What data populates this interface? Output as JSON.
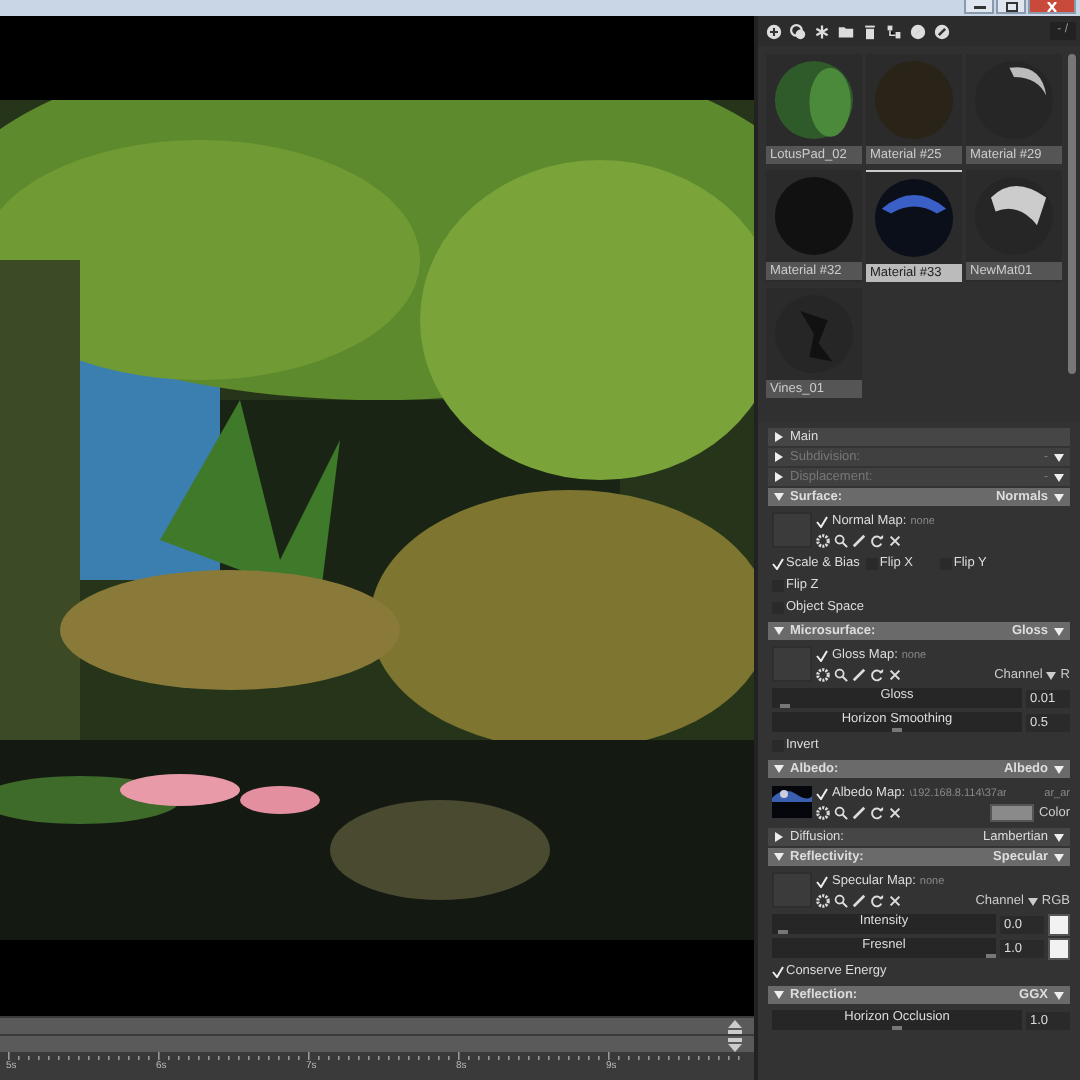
{
  "toolbar": {
    "page_field": "- /"
  },
  "materials": [
    {
      "name": "LotusPad_02",
      "selected": false,
      "kind": "leaf"
    },
    {
      "name": "Material #25",
      "selected": false,
      "kind": "dark"
    },
    {
      "name": "Material #29",
      "selected": false,
      "kind": "partial"
    },
    {
      "name": "Material #32",
      "selected": false,
      "kind": "black"
    },
    {
      "name": "Material #33",
      "selected": true,
      "kind": "sky"
    },
    {
      "name": "NewMat01",
      "selected": false,
      "kind": "speckle"
    },
    {
      "name": "Vines_01",
      "selected": false,
      "kind": "vines"
    }
  ],
  "sections": [
    {
      "title": "Main",
      "expanded": false,
      "disabled": false
    },
    {
      "title": "Subdivision:",
      "value": "-",
      "expanded": false,
      "disabled": true
    },
    {
      "title": "Displacement:",
      "value": "-",
      "expanded": false,
      "disabled": true
    },
    {
      "title": "Surface:",
      "value": "Normals",
      "expanded": true,
      "disabled": false,
      "rows": [
        {
          "kind": "map",
          "label": "Normal Map:",
          "value": "none",
          "checked": true,
          "filled": false
        },
        {
          "kind": "checks",
          "items": [
            {
              "label": "Scale & Bias",
              "checked": true
            },
            {
              "label": "Flip X",
              "checked": false
            },
            {
              "label": "Flip Y",
              "checked": false
            },
            {
              "label": "Flip Z",
              "checked": false
            },
            {
              "label": "Object Space",
              "checked": false
            }
          ]
        }
      ]
    },
    {
      "title": "Microsurface:",
      "value": "Gloss",
      "expanded": true,
      "disabled": false,
      "rows": [
        {
          "kind": "map",
          "label": "Gloss Map:",
          "value": "none",
          "checked": true,
          "filled": false,
          "channel_label": "Channel",
          "channel": "R"
        },
        {
          "kind": "slider",
          "label": "Gloss",
          "level": 0.03,
          "reading": "0.01"
        },
        {
          "kind": "slider",
          "label": "Horizon Smoothing",
          "level": 0.5,
          "reading": "0.5"
        },
        {
          "kind": "checks",
          "items": [
            {
              "label": "Invert",
              "checked": false
            }
          ]
        }
      ]
    },
    {
      "title": "Albedo:",
      "value": "Albedo",
      "expanded": true,
      "disabled": false,
      "rows": [
        {
          "kind": "map",
          "label": "Albedo Map:",
          "value": "\\192.168.8.114\\37ar",
          "extra": "ar_ar",
          "checked": true,
          "filled": true,
          "swatch_label": "Color",
          "color": "#8a8a8a"
        }
      ]
    },
    {
      "title": "Diffusion:",
      "value": "Lambertian",
      "expanded": false,
      "disabled": false
    },
    {
      "title": "Reflectivity:",
      "value": "Specular",
      "expanded": true,
      "disabled": false,
      "rows": [
        {
          "kind": "map",
          "label": "Specular Map:",
          "value": "none",
          "checked": true,
          "filled": false,
          "channel_label": "Channel",
          "channel": "RGB"
        },
        {
          "kind": "slider",
          "label": "Intensity",
          "level": 0.03,
          "reading": "0.0",
          "color": "#f2f2f2"
        },
        {
          "kind": "slider",
          "label": "Fresnel",
          "level": 1,
          "reading": "1.0",
          "color": "#f2f2f2"
        },
        {
          "kind": "checks",
          "items": [
            {
              "label": "Conserve Energy",
              "checked": true
            }
          ]
        }
      ]
    },
    {
      "title": "Reflection:",
      "value": "GGX",
      "expanded": true,
      "disabled": false,
      "rows": [
        {
          "kind": "slider",
          "label": "Horizon Occlusion",
          "level": 0.5,
          "reading": "1.0"
        }
      ]
    }
  ],
  "timeline": {
    "labels": [
      "5s",
      "6s",
      "7s",
      "8s",
      "9s"
    ]
  }
}
